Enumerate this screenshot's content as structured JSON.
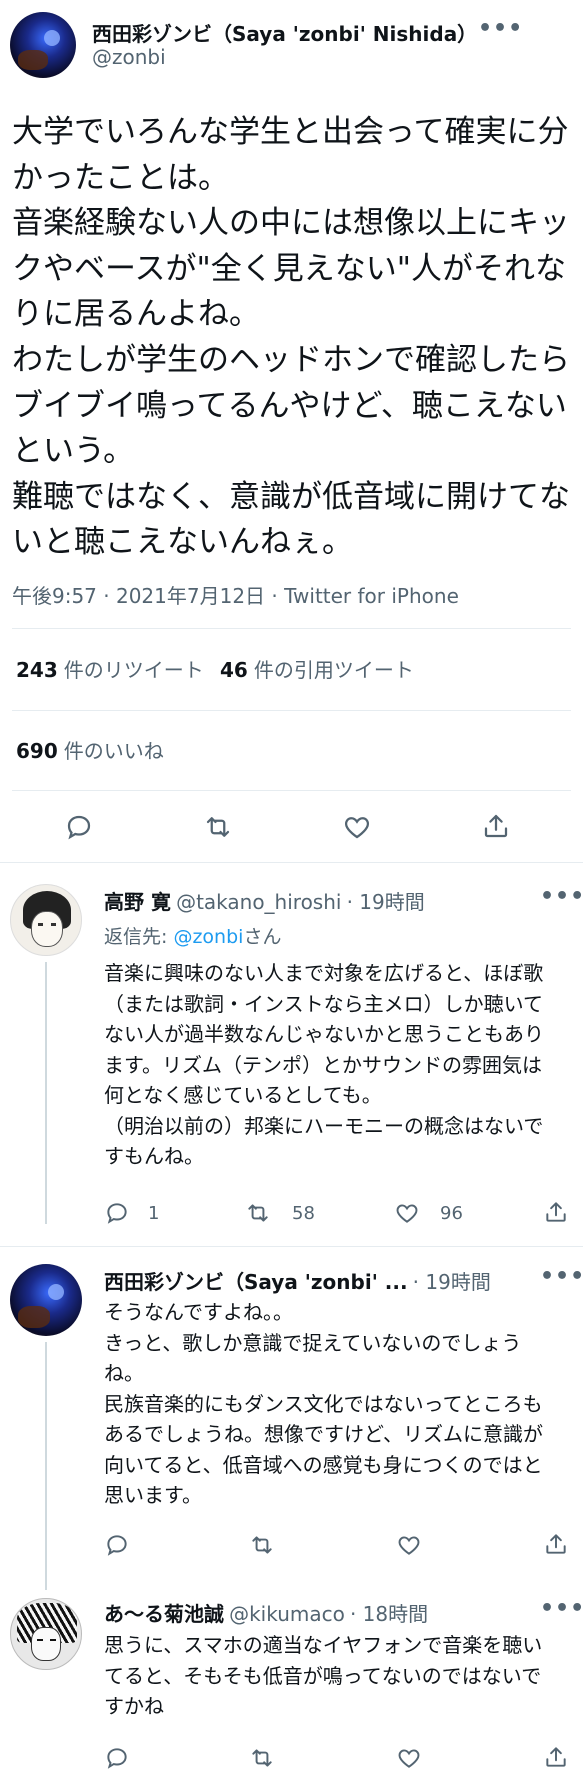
{
  "main_tweet": {
    "author_name": "西田彩ゾンビ（Saya 'zonbi' Nishida）",
    "author_handle": "@zonbi",
    "text": "大学でいろんな学生と出会って確実に分かったことは。\n音楽経験ない人の中には想像以上にキックやベースが\"全く見えない\"人がそれなりに居るんよね。\nわたしが学生のヘッドホンで確認したらブイブイ鳴ってるんやけど、聴こえないという。\n難聴ではなく、意識が低音域に開けてないと聴こえないんねぇ。",
    "timestamp": "午後9:57 · 2021年7月12日 · Twitter for iPhone",
    "retweets_count": "243",
    "retweets_label": "件のリツイート",
    "quotes_count": "46",
    "quotes_label": "件の引用ツイート",
    "likes_count": "690",
    "likes_label": "件のいいね"
  },
  "replies": [
    {
      "author_name": "高野 寛",
      "author_handle": "@takano_hiroshi",
      "time": "· 19時間",
      "reply_to_prefix": "返信先: ",
      "reply_to_handle": "@zonbi",
      "reply_to_suffix": "さん",
      "text": "音楽に興味のない人まで対象を広げると、ほぼ歌（または歌詞・インストなら主メロ）しか聴いてない人が過半数なんじゃないかと思うこともあります。リズム（テンポ）とかサウンドの雰囲気は何となく感じているとしても。\n（明治以前の）邦楽にハーモニーの概念はないですもんね。",
      "reply_count": "1",
      "retweet_count": "58",
      "like_count": "96"
    },
    {
      "author_name": "西田彩ゾンビ（Saya 'zonbi' ...",
      "author_handle": "",
      "time": "· 19時間",
      "text": "そうなんですよね。。\nきっと、歌しか意識で捉えていないのでしょうね。\n民族音楽的にもダンス文化ではないってところもあるでしょうね。想像ですけど、リズムに意識が向いてると、低音域への感覚も身につくのではと思います。",
      "reply_count": "",
      "retweet_count": "",
      "like_count": ""
    },
    {
      "author_name": "あ〜る菊池誠",
      "author_handle": "@kikumaco",
      "time": "· 18時間",
      "text": "思うに、スマホの適当なイヤフォンで音楽を聴いてると、そもそも低音が鳴ってないのではないですかね",
      "reply_count": "",
      "retweet_count": "",
      "like_count": ""
    }
  ],
  "icons": [
    "more-icon",
    "reply-icon",
    "retweet-icon",
    "like-icon",
    "share-icon"
  ],
  "colors": {
    "text": "#0f1419",
    "secondary": "#536471",
    "link": "#1d9bf0",
    "divider": "#e6ecf0"
  }
}
